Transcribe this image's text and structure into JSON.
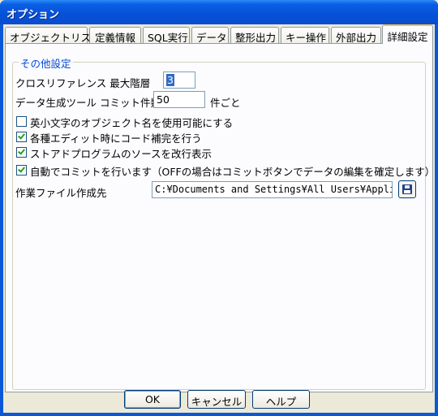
{
  "window": {
    "title": "オプション"
  },
  "tabs": [
    {
      "label": "オブジェクトリスト"
    },
    {
      "label": "定義情報"
    },
    {
      "label": "SQL実行"
    },
    {
      "label": "データ"
    },
    {
      "label": "整形出力"
    },
    {
      "label": "キー操作"
    },
    {
      "label": "外部出力"
    },
    {
      "label": "詳細設定"
    }
  ],
  "active_tab": "詳細設定",
  "group": {
    "title": "その他設定",
    "cross_ref_label": "クロスリファレンス 最大階層",
    "cross_ref_value": "3",
    "commit_label": "データ生成ツール コミット件数",
    "commit_value": "50",
    "commit_unit": "件ごと",
    "checkboxes": [
      {
        "label": "英小文字のオブジェクト名を使用可能にする",
        "checked": false
      },
      {
        "label": "各種エディット時にコード補完を行う",
        "checked": true
      },
      {
        "label": "ストアドプログラムのソースを改行表示",
        "checked": true
      },
      {
        "label": "自動でコミットを行います（OFFの場合はコミットボタンでデータの編集を確定します）",
        "checked": true
      }
    ],
    "workdir_label": "作業ファイル作成先",
    "workdir_value": "C:¥Documents and Settings¥All Users¥Applic"
  },
  "buttons": {
    "ok": "OK",
    "cancel": "キャンセル",
    "help": "ヘルプ"
  },
  "icons": {
    "browse": "floppy-disk-icon"
  }
}
